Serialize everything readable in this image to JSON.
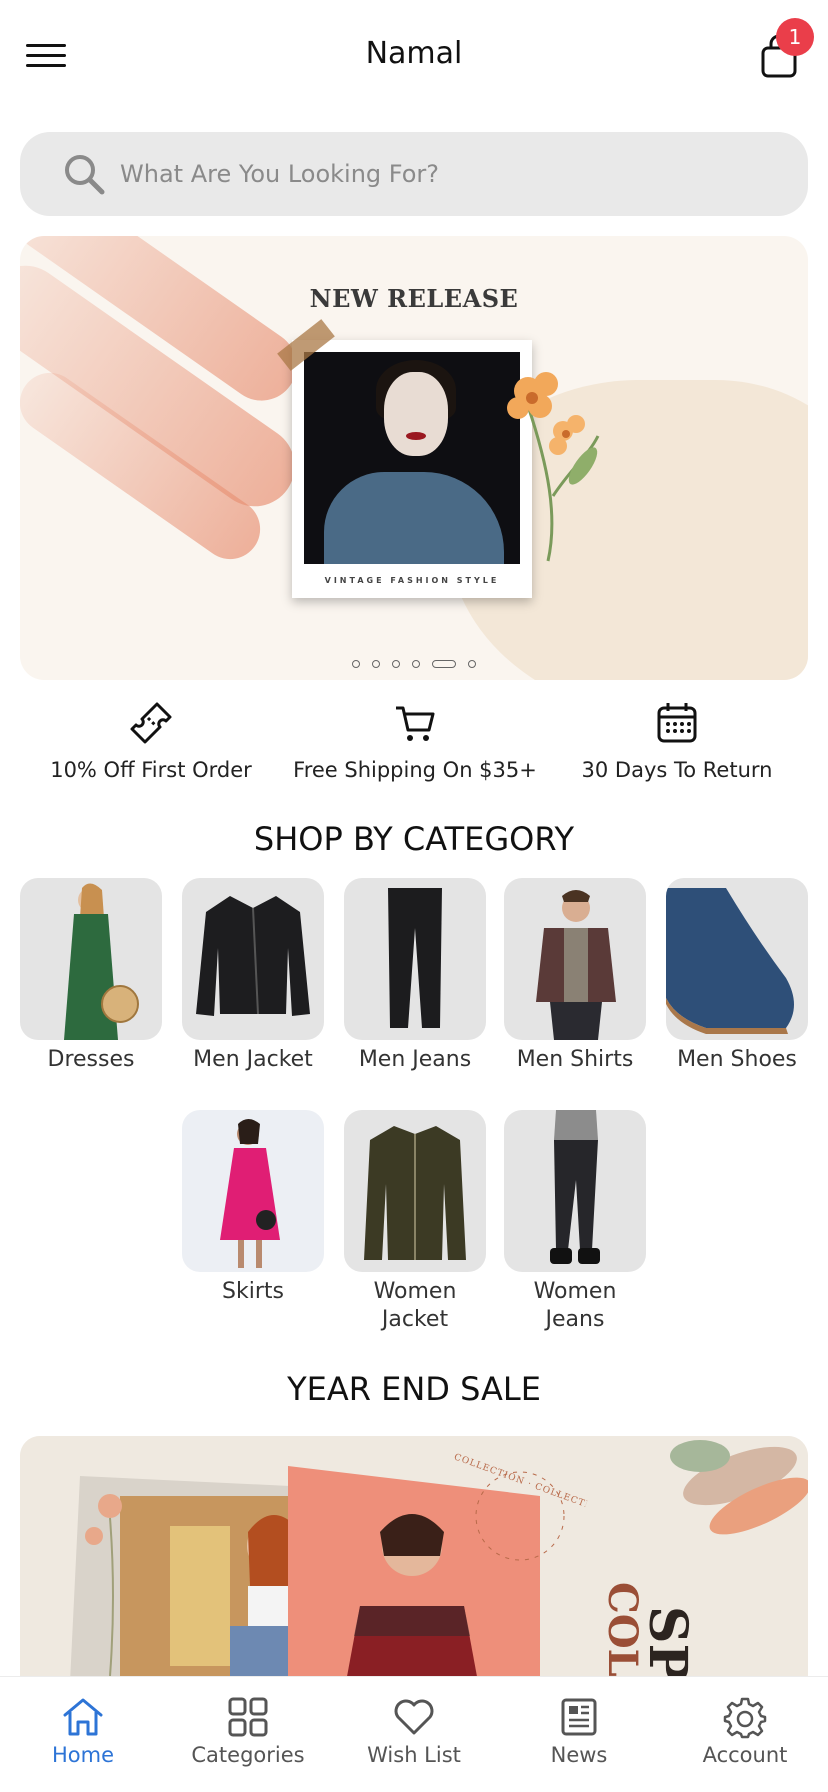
{
  "header": {
    "title": "Namal",
    "cart_count": "1",
    "menu_icon": "hamburger-icon",
    "cart_icon": "shopping-bag-icon"
  },
  "search": {
    "placeholder": "What Are You Looking For?",
    "value": ""
  },
  "banner": {
    "heading": "NEW RELEASE",
    "caption": "VINTAGE FASHION STYLE",
    "slide_count": 6,
    "active_slide": 5
  },
  "perks": [
    {
      "icon": "ticket-icon",
      "label": "10% Off First Order"
    },
    {
      "icon": "cart-icon",
      "label": "Free Shipping On $35+"
    },
    {
      "icon": "calendar-icon",
      "label": "30 Days To Return"
    }
  ],
  "shop_by_category": {
    "title": "SHOP BY CATEGORY",
    "items": [
      {
        "label": "Dresses"
      },
      {
        "label": "Men Jacket"
      },
      {
        "label": "Men Jeans"
      },
      {
        "label": "Men Shirts"
      },
      {
        "label": "Men Shoes"
      },
      {
        "label": "Skirts"
      },
      {
        "label": "Women Jacket"
      },
      {
        "label": "Women Jeans"
      }
    ]
  },
  "year_end_sale": {
    "title": "YEAR END SALE",
    "banner_text": [
      "COLLECTION · COLLECTION · COLLECTION",
      "SPR",
      "COLL"
    ]
  },
  "bottom_nav": {
    "items": [
      {
        "label": "Home",
        "icon": "home-icon",
        "active": true
      },
      {
        "label": "Categories",
        "icon": "grid-icon",
        "active": false
      },
      {
        "label": "Wish List",
        "icon": "heart-icon",
        "active": false
      },
      {
        "label": "News",
        "icon": "newspaper-icon",
        "active": false
      },
      {
        "label": "Account",
        "icon": "gear-icon",
        "active": false
      }
    ]
  },
  "colors": {
    "accent": "#2d74d6",
    "badge": "#ea3e4a",
    "search_bg": "#e9e9e9",
    "card_bg": "#e4e4e4"
  }
}
